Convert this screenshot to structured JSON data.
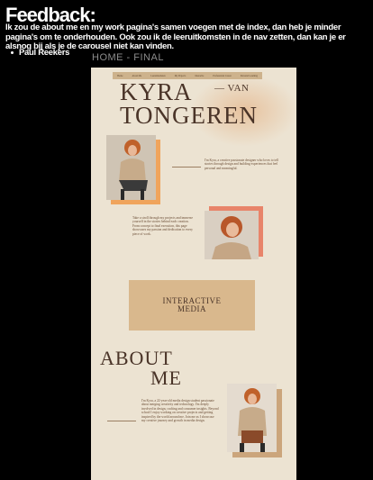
{
  "feedback": {
    "title": "Feedback:",
    "body": "Ik zou de about me en my work pagina's samen voegen met de index, dan heb je minder pagina's om te onderhouden. Ook zou ik de leeruitkomsten in de nav zetten, dan kan je er alsnog bij als je de carousel niet kan vinden.",
    "author": "Paul Reekers"
  },
  "frame": {
    "label": "HOME - FINAL"
  },
  "mockup": {
    "nav_items": [
      "Home",
      "About Me",
      "Leeruitkomsten",
      "My Projects",
      "Interactie",
      "Professional Career",
      "Personal Learning"
    ],
    "hero_first": "KYRA",
    "hero_van": "— VAN",
    "hero_last": "TONGEREN",
    "intro_text": "I'm Kyra, a creative passionate designer who loves to tell stories through design and building experiences that feel personal and meaningful.",
    "side_text": "Take a stroll through my projects and immerse yourself in the stories behind each creation. From concept to final execution, this page showcases my passion and dedication to every piece of work.",
    "block_label_1": "INTERACTIVE",
    "block_label_2": "MEDIA",
    "about_1": "ABOUT",
    "about_2": "ME",
    "about_text": "I'm Kyra, a 22-year-old media design student passionate about merging creativity and technology. I'm deeply involved in design, crafting and consumer insights. Beyond school I enjoy working on creative projects and getting inspired by the world around me. Join me as I showcase my creative journey and growth in media design."
  },
  "colors": {
    "background": "#000000",
    "mock_bg": "#ece3d2",
    "accent_orange": "#f0a45c",
    "accent_salmon": "#e8846a",
    "tan_block": "#d9b88d"
  }
}
